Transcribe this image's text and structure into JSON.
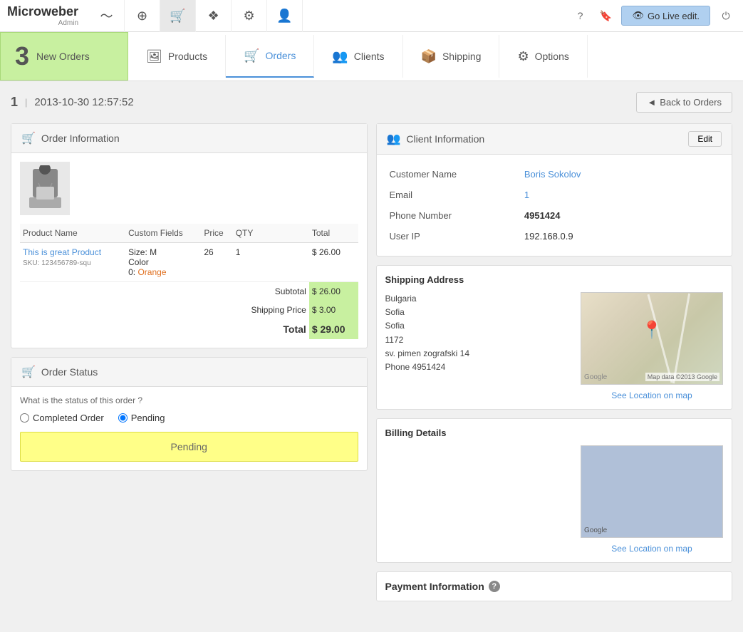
{
  "app": {
    "logo": "Microweber",
    "logo_sub": "Admin",
    "go_live_label": "Go Live edit."
  },
  "top_nav": {
    "icons": [
      {
        "name": "analytics-icon",
        "symbol": "〜"
      },
      {
        "name": "globe-icon",
        "symbol": "⊕"
      },
      {
        "name": "cart-icon",
        "symbol": "🛒"
      },
      {
        "name": "workflow-icon",
        "symbol": "⬡"
      },
      {
        "name": "settings-icon",
        "symbol": "⚙"
      },
      {
        "name": "user-icon",
        "symbol": "👤"
      }
    ]
  },
  "sub_nav": {
    "new_orders_count": "3",
    "new_orders_label": "New Orders",
    "tabs": [
      {
        "label": "Products",
        "icon": "🖼",
        "active": false
      },
      {
        "label": "Orders",
        "icon": "🛒",
        "active": true
      },
      {
        "label": "Clients",
        "icon": "👥",
        "active": false
      },
      {
        "label": "Shipping",
        "icon": "📦",
        "active": false
      },
      {
        "label": "Options",
        "icon": "⚙",
        "active": false
      }
    ]
  },
  "order": {
    "id": "1",
    "date": "2013-10-30 12:57:52",
    "back_btn": "Back to Orders"
  },
  "order_info": {
    "panel_title": "Order Information",
    "columns": [
      "Product Name",
      "Custom Fields",
      "Price",
      "QTY",
      "Total"
    ],
    "items": [
      {
        "name": "This is great Product",
        "sku": "SKU: 123456789-squ",
        "custom_field_label1": "Size:",
        "custom_field_value1": "M",
        "custom_field_label2": "Color",
        "custom_field_label3": "0:",
        "custom_field_value3": "Orange",
        "price": "26",
        "qty": "1",
        "total": "$ 26.00"
      }
    ],
    "subtotal_label": "Subtotal",
    "subtotal_value": "$ 26.00",
    "shipping_label": "Shipping Price",
    "shipping_value": "$ 3.00",
    "total_label": "Total",
    "total_value": "$ 29.00"
  },
  "order_status": {
    "panel_title": "Order Status",
    "question": "What is the status of this order ?",
    "option1": "Completed Order",
    "option2": "Pending",
    "current": "Pending"
  },
  "client_info": {
    "panel_title": "Client Information",
    "edit_label": "Edit",
    "customer_name_label": "Customer Name",
    "customer_name_value": "Boris Sokolov",
    "email_label": "Email",
    "email_value": "1",
    "phone_label": "Phone Number",
    "phone_value": "4951424",
    "user_ip_label": "User IP",
    "user_ip_value": "192.168.0.9"
  },
  "shipping": {
    "title": "Shipping Address",
    "country": "Bulgaria",
    "city1": "Sofia",
    "city2": "Sofia",
    "postal": "1172",
    "street": "sv. pimen zografski 14",
    "phone": "Phone 4951424",
    "see_location": "See Location on map",
    "map_label": "Map data ©2013 Google"
  },
  "billing": {
    "title": "Billing Details",
    "see_location": "See Location on map"
  },
  "payment": {
    "title": "Payment Information",
    "help": "?"
  }
}
